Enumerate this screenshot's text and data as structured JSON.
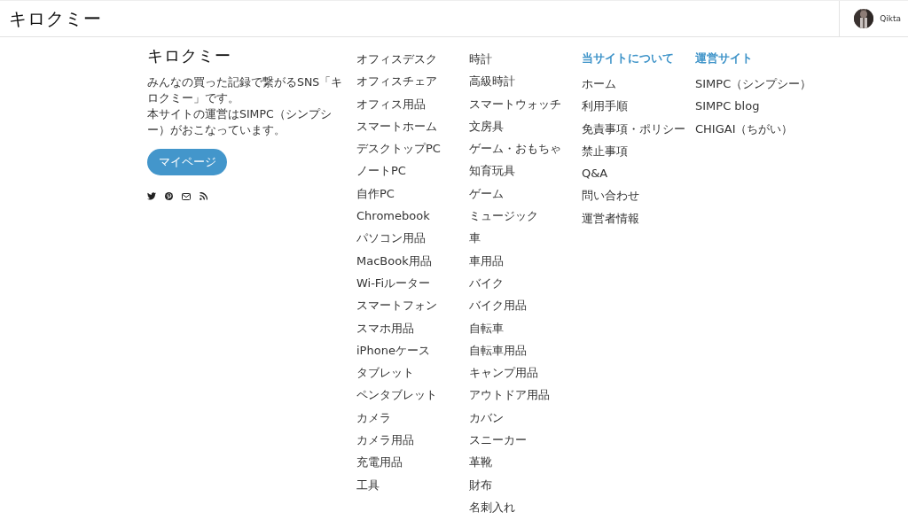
{
  "header": {
    "logo": "キロクミー",
    "user": {
      "name": "Qikta"
    }
  },
  "about": {
    "title": "キロクミー",
    "description": [
      "みんなの買った記録で繋がるSNS「キロクミー」です。",
      "本サイトの運営はSIMPC（シンプシー）がおこなっています。"
    ],
    "button": "マイページ",
    "social": [
      {
        "kind": "twitter"
      },
      {
        "kind": "pinterest"
      },
      {
        "kind": "mail"
      },
      {
        "kind": "rss"
      }
    ]
  },
  "categories": [
    [
      "オフィスデスク",
      "オフィスチェア",
      "オフィス用品",
      "スマートホーム",
      "デスクトップPC",
      "ノートPC",
      "自作PC",
      "Chromebook",
      "パソコン用品",
      "MacBook用品",
      "Wi-Fiルーター",
      "スマートフォン",
      "スマホ用品",
      "iPhoneケース",
      "タブレット",
      "ペンタブレット",
      "カメラ",
      "カメラ用品",
      "充電用品",
      "工具"
    ],
    [
      "時計",
      "高級時計",
      "スマートウォッチ",
      "文房具",
      "ゲーム・おもちゃ",
      "知育玩具",
      "ゲーム",
      "ミュージック",
      "車",
      "車用品",
      "バイク",
      "バイク用品",
      "自転車",
      "自転車用品",
      "キャンプ用品",
      "アウトドア用品",
      "カバン",
      "スニーカー",
      "革靴",
      "財布",
      "名刺入れ"
    ]
  ],
  "link_sections": [
    {
      "title": "当サイトについて",
      "links": [
        "ホーム",
        "利用手順",
        "免責事項・ポリシー",
        "禁止事項",
        "Q&A",
        "問い合わせ",
        "運営者情報"
      ]
    },
    {
      "title": "運営サイト",
      "links": [
        "SIMPC（シンプシー）",
        "SIMPC blog",
        "CHIGAI（ちがい）"
      ]
    }
  ]
}
